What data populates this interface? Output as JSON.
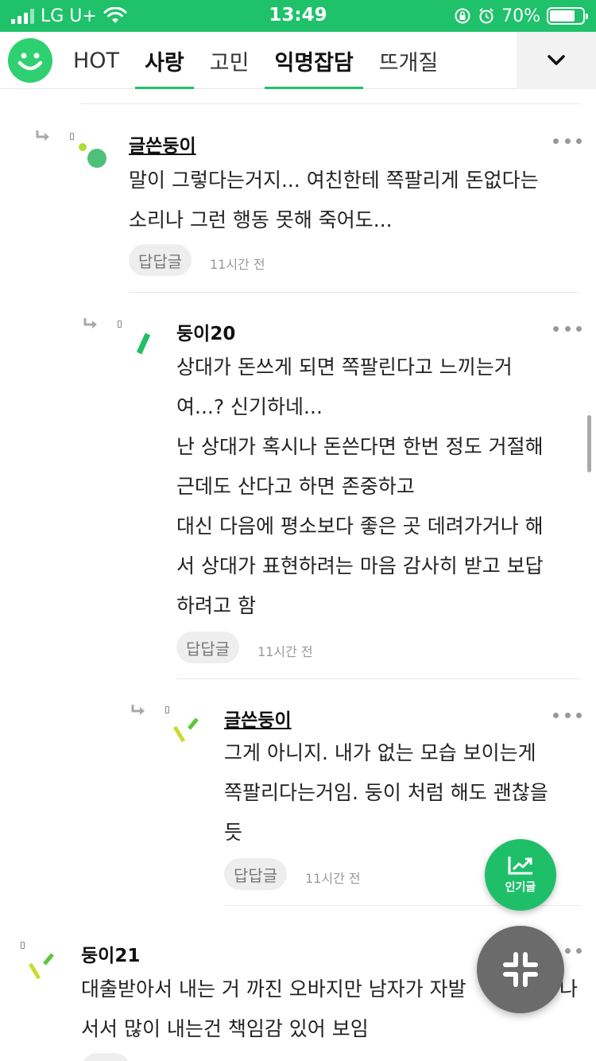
{
  "status_bar": {
    "carrier": "LG U+",
    "time": "13:49",
    "battery": "70%"
  },
  "nav": {
    "tabs": [
      {
        "label": "HOT"
      },
      {
        "label": "사랑"
      },
      {
        "label": "고민"
      },
      {
        "label": "익명잡담"
      },
      {
        "label": "뜨개질"
      }
    ]
  },
  "comments": [
    {
      "author": "글쓴둥이",
      "lines": [
        "말이 그렇다는거지... 여친한테 쪽팔리게 돈없다는",
        "소리나 그런 행동 못해 죽어도..."
      ],
      "reply_label": "답답글",
      "time": "11시간 전"
    },
    {
      "author": "둥이20",
      "lines": [
        "상대가 돈쓰게 되면 쪽팔린다고 느끼는거",
        "여...? 신기하네...",
        "난 상대가 혹시나 돈쓴다면 한번 정도 거절해",
        "근데도 산다고 하면 존중하고",
        "대신 다음에 평소보다 좋은 곳 데려가거나 해",
        "서 상대가 표현하려는 마음 감사히 받고 보답",
        "하려고 함"
      ],
      "reply_label": "답답글",
      "time": "11시간 전"
    },
    {
      "author": "글쓴둥이",
      "lines": [
        "그게 아니지. 내가 없는 모습 보이는게",
        "쪽팔리다는거임. 둥이 처럼 해도 괜찮을",
        "듯"
      ],
      "reply_label": "답답글",
      "time": "11시간 전"
    },
    {
      "author": "둥이21",
      "lines": [
        "대출받아서 내는 거 까진 오바지만 남자가 자발",
        "서서 많이 내는건 책임감 있어 보임"
      ],
      "lines_tail": "나"
    }
  ],
  "fab": {
    "popular_label": "인기글"
  },
  "colors": {
    "brand_green": "#1fc16b",
    "fab_gray": "#6b6b6b"
  }
}
